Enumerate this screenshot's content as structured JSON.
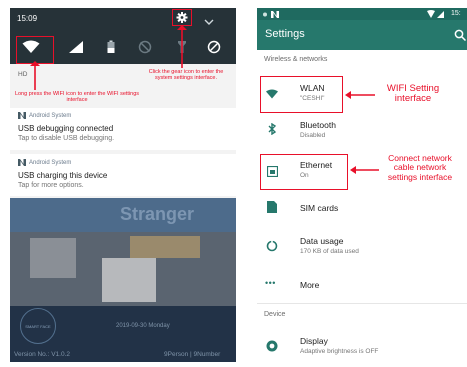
{
  "left": {
    "time": "15:09",
    "hd": "HD",
    "notifications": [
      {
        "app": "Android System",
        "title": "USB debugging connected",
        "sub": "Tap to disable USB debugging."
      },
      {
        "app": "Android System",
        "title": "USB charging this device",
        "sub": "Tap for more options."
      }
    ],
    "lock": {
      "banner": "Stranger",
      "date": "2019-09-30 Monday",
      "version": "Version No.: V1.0.2",
      "count": "9Person | 9Number",
      "logo": "SMART FACE"
    },
    "annotations": {
      "wifi_hint": "Long press the WIFI icon to enter the WIFI settings interface",
      "gear_hint": "Click the gear icon to enter the system settings interface."
    }
  },
  "right": {
    "statusbar": {
      "time": "15:"
    },
    "title": "Settings",
    "sections": {
      "wireless": "Wireless & networks",
      "device": "Device"
    },
    "items": [
      {
        "title": "WLAN",
        "sub": "\"CESHI\""
      },
      {
        "title": "Bluetooth",
        "sub": "Disabled"
      },
      {
        "title": "Ethernet",
        "sub": "On"
      },
      {
        "title": "SIM cards",
        "sub": ""
      },
      {
        "title": "Data usage",
        "sub": "170 KB of data used"
      },
      {
        "title": "More",
        "sub": ""
      },
      {
        "title": "Display",
        "sub": "Adaptive brightness is OFF"
      }
    ],
    "annotations": {
      "wifi": "WIFI Setting interface",
      "ethernet": "Connect network cable network settings interface"
    }
  },
  "colors": {
    "accent": "#26786c",
    "annotation": "#e8102a",
    "shade": "#263238"
  }
}
